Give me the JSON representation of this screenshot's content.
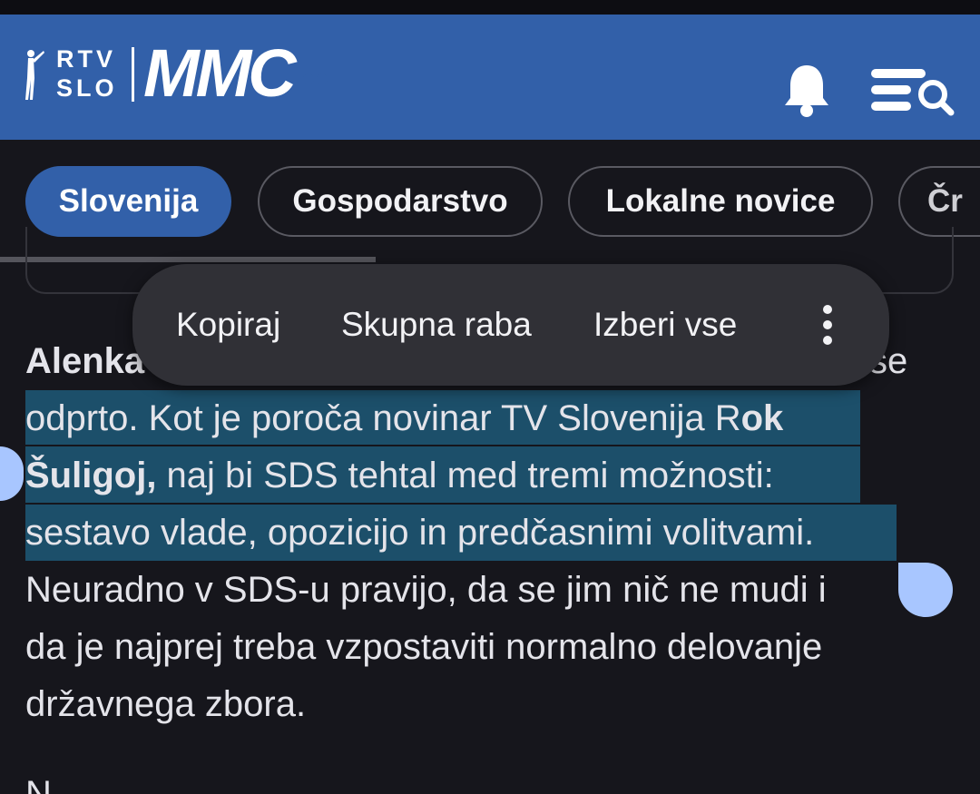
{
  "header": {
    "logo_rtv": "RTV",
    "logo_slo": "SLO",
    "logo_mmc": "MMC",
    "colors": {
      "bar": "#3260a9",
      "selection": "#1c4f6a",
      "handle": "#a8c6ff"
    },
    "icons": [
      "bell-icon",
      "menu-search-icon"
    ]
  },
  "tabs": [
    {
      "label": "Slovenija",
      "active": true
    },
    {
      "label": "Gospodarstvo",
      "active": false
    },
    {
      "label": "Lokalne novice",
      "active": false
    },
    {
      "label": "Čr",
      "active": false
    }
  ],
  "article": {
    "l1_bold": "Alenka",
    "l1_end": "vse",
    "l2_normal": "odprto. Kot je poroča novinar TV Slovenija R",
    "l2_bold": "ok",
    "l3_bold": "Šuligoj,",
    "l3_normal": " naj bi SDS tehtal med tremi možnosti:",
    "l4": "sestavo vlade, opozicijo in predčasnimi volitvami.",
    "l5": "Neuradno v SDS-u pravijo, da se jim nič ne mudi i",
    "l6": "da je najprej treba vzpostaviti normalno delovanje",
    "l7": "državnega zbora."
  },
  "context_menu": {
    "copy": "Kopiraj",
    "share": "Skupna raba",
    "select_all": "Izberi vse",
    "more_icon": "more-vertical-icon"
  }
}
